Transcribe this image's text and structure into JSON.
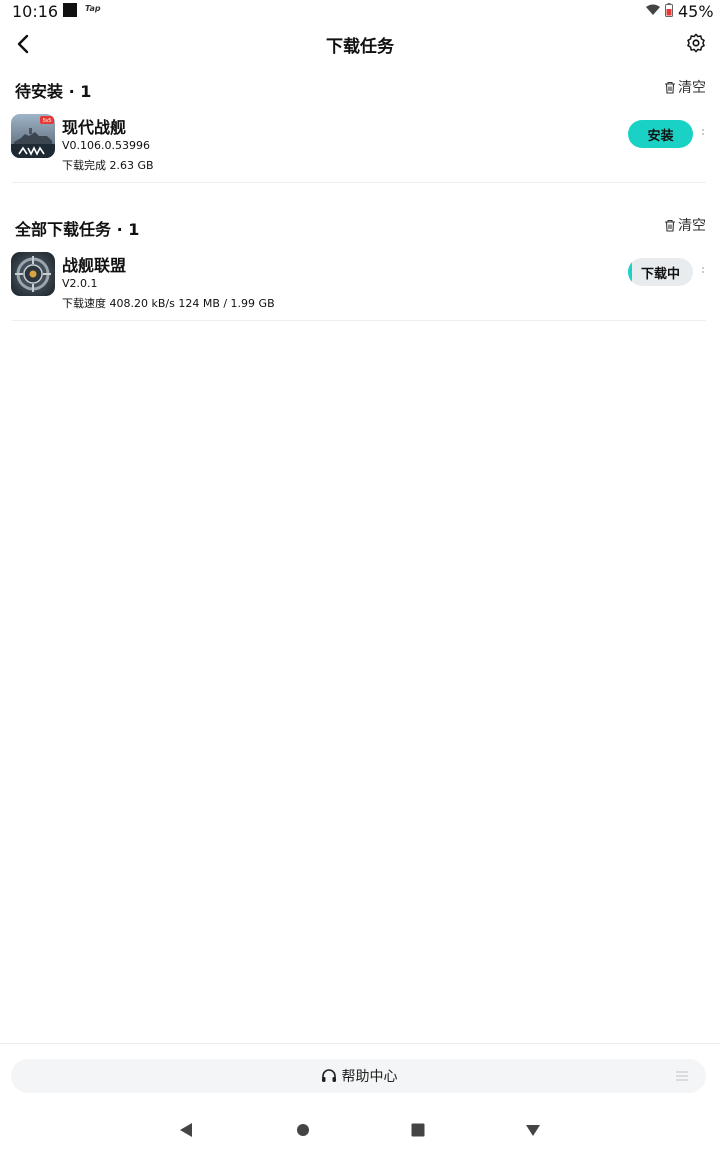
{
  "status_bar": {
    "time": "10:16",
    "notification_app": "Tap",
    "battery_percent": "45%",
    "icons": [
      "notification-square-icon",
      "wifi-icon",
      "battery-low-icon"
    ]
  },
  "header": {
    "title": "下载任务",
    "back_icon": "chevron-left-icon",
    "settings_icon": "gear-icon"
  },
  "pending_section": {
    "title": "待安装 · 1",
    "clear_label": "清空",
    "items": [
      {
        "name": "现代战舰",
        "version": "V0.106.0.53996",
        "status_line": "下载完成 2.63 GB",
        "icon_badge": "5v5",
        "action_label": "安装"
      }
    ]
  },
  "all_section": {
    "title": "全部下载任务 · 1",
    "clear_label": "清空",
    "items": [
      {
        "name": "战舰联盟",
        "version": "V2.0.1",
        "status_line": "下载速度 408.20 kB/s 124 MB / 1.99 GB",
        "action_label": "下载中",
        "progress": 0.062
      }
    ]
  },
  "footer": {
    "help_label": "帮助中心",
    "help_icon": "headset-icon",
    "menu_icon": "menu-lines-icon"
  },
  "nav_bar": {
    "icons": [
      "back-triangle-icon",
      "home-circle-icon",
      "recents-square-icon",
      "dropdown-triangle-icon"
    ]
  },
  "colors": {
    "accent": "#1ad1c6",
    "downloading_bg": "#e8ecef",
    "help_bg": "#f4f5f6"
  }
}
